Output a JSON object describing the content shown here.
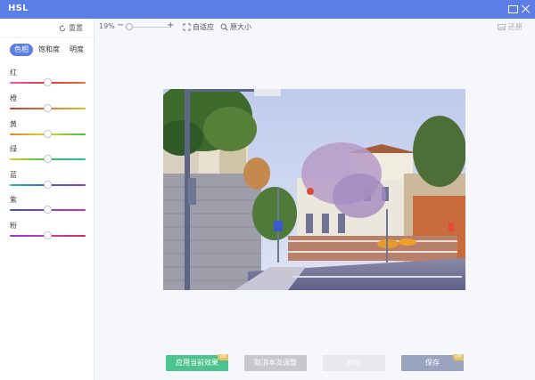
{
  "window": {
    "title": "HSL"
  },
  "sidebar": {
    "reset_label": "重置",
    "tabs": [
      {
        "label": "色相",
        "active": true
      },
      {
        "label": "饱和度",
        "active": false
      },
      {
        "label": "明度",
        "active": false
      }
    ],
    "sliders": [
      {
        "label": "红",
        "value": 0,
        "gradient": [
          "#e85ca8",
          "#e23a3a",
          "#e4742a"
        ]
      },
      {
        "label": "橙",
        "value": 0,
        "gradient": [
          "#c83a3a",
          "#e0782a",
          "#d8c22a"
        ]
      },
      {
        "label": "黄",
        "value": 0,
        "gradient": [
          "#e2862a",
          "#e0cf2a",
          "#3cc23c"
        ]
      },
      {
        "label": "绿",
        "value": 0,
        "gradient": [
          "#d6cf2a",
          "#3cc24c",
          "#2ab8b0"
        ]
      },
      {
        "label": "蓝",
        "value": 0,
        "gradient": [
          "#2ab8a8",
          "#3a62d8",
          "#8a3ad8"
        ]
      },
      {
        "label": "紫",
        "value": 0,
        "gradient": [
          "#3a52d8",
          "#8a3ad8",
          "#c83aa8"
        ]
      },
      {
        "label": "粉",
        "value": 0,
        "gradient": [
          "#8a3ad8",
          "#c83aa8",
          "#d82a5a"
        ]
      }
    ]
  },
  "toolbar": {
    "zoom_percent": "19%",
    "zoom_minus": "−",
    "zoom_plus": "+",
    "fit_label": "自适应",
    "actual_size_label": "原大小",
    "restore_label": "还原"
  },
  "actions": {
    "apply_label": "应用当前效果",
    "cancel_label": "取消本次调整",
    "compare_label": "对比",
    "save_label": "保存",
    "vip_badge": "VIP"
  },
  "colors": {
    "titlebar": "#5b7ee6",
    "accent": "#5b7ee6",
    "apply": "#4cc28d",
    "vip": "#e8c36a"
  }
}
